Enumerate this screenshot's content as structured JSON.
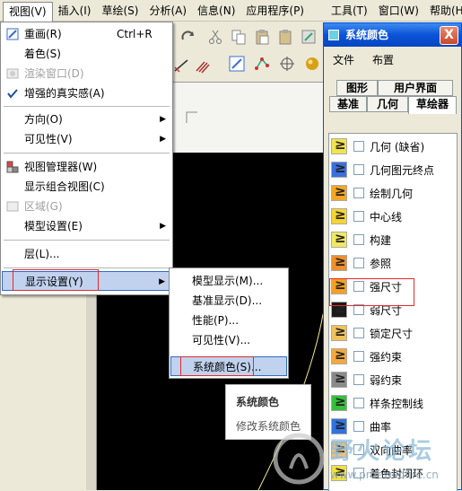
{
  "menubar": {
    "items": [
      {
        "label": "视图(V)"
      },
      {
        "label": "插入(I)"
      },
      {
        "label": "草绘(S)"
      },
      {
        "label": "分析(A)"
      },
      {
        "label": "信息(N)"
      },
      {
        "label": "应用程序(P)"
      }
    ],
    "right_items": [
      {
        "label": "工具(T)"
      },
      {
        "label": "窗口(W)"
      },
      {
        "label": "帮助(H)"
      }
    ]
  },
  "view_menu": {
    "items": [
      {
        "label": "重画(R)",
        "accel": "Ctrl+R"
      },
      {
        "label": "着色(S)"
      },
      {
        "label": "渲染窗口(D)"
      },
      {
        "label": "增强的真实感(A)"
      },
      {
        "label": "方向(O)"
      },
      {
        "label": "可见性(V)"
      },
      {
        "label": "视图管理器(W)"
      },
      {
        "label": "显示组合视图(C)"
      },
      {
        "label": "区域(G)"
      },
      {
        "label": "模型设置(E)"
      },
      {
        "label": "层(L)..."
      },
      {
        "label": "显示设置(Y)"
      }
    ]
  },
  "display_submenu": {
    "items": [
      {
        "label": "模型显示(M)..."
      },
      {
        "label": "基准显示(D)..."
      },
      {
        "label": "性能(P)..."
      },
      {
        "label": "可见性(V)..."
      },
      {
        "label": "系统颜色(S)..."
      }
    ]
  },
  "tooltip": {
    "title": "系统颜色",
    "description": "修改系统颜色"
  },
  "system_color_window": {
    "title": "系统颜色",
    "close": "X",
    "menu": [
      "文件",
      "布置"
    ],
    "tabs_row1": [
      "图形",
      "用户界面"
    ],
    "tabs_row2": [
      "基准",
      "几何",
      "草绘器"
    ],
    "rows": [
      {
        "label": "几何 (缺省)",
        "color": "#f1e34a"
      },
      {
        "label": "几何图元终点",
        "color": "#3a6fe0"
      },
      {
        "label": "绘制几何",
        "color": "#f5a623"
      },
      {
        "label": "中心线",
        "color": "#f5d430"
      },
      {
        "label": "构建",
        "color": "#f0e860"
      },
      {
        "label": "参照",
        "color": "#f0902a"
      },
      {
        "label": "强尺寸",
        "color": "#f5a020"
      },
      {
        "label": "弱尺寸",
        "color": "#1a1a1a"
      },
      {
        "label": "锁定尺寸",
        "color": "#f2c25a"
      },
      {
        "label": "强约束",
        "color": "#f5a93a"
      },
      {
        "label": "弱约束",
        "color": "#8a8a8a"
      },
      {
        "label": "样条控制线",
        "color": "#36c13a"
      },
      {
        "label": "曲率",
        "color": "#2f73e0"
      },
      {
        "label": "双向曲率",
        "color": "#f0c07a"
      },
      {
        "label": "着色封闭环",
        "color": "#f0e040"
      }
    ]
  },
  "watermark": {
    "main": "野火论坛",
    "url": "www.proewildfire.cn"
  }
}
